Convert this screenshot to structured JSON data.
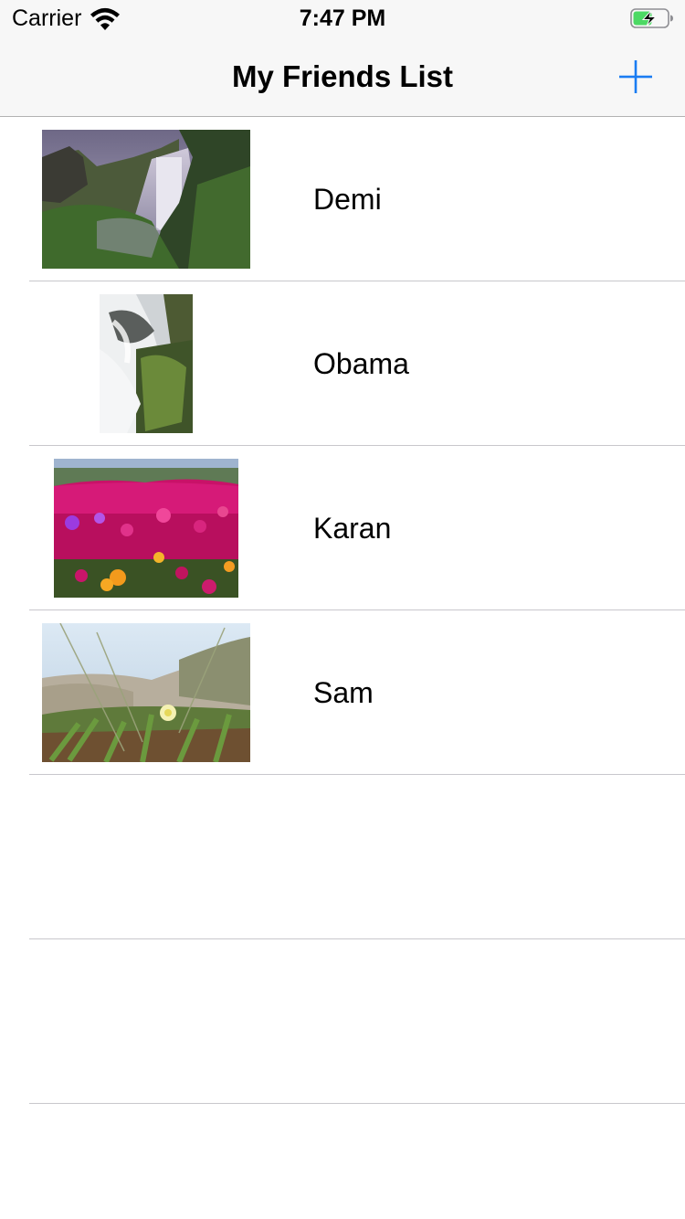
{
  "status_bar": {
    "carrier": "Carrier",
    "time": "7:47 PM",
    "wifi_icon": "wifi-icon",
    "battery_icon": "battery-charging-icon"
  },
  "nav_bar": {
    "title": "My Friends List",
    "add_icon": "plus-icon",
    "accent_color": "#1a7cf2"
  },
  "friends": [
    {
      "name": "Demi",
      "photo": "waterfall-cliff-photo"
    },
    {
      "name": "Obama",
      "photo": "waterfall-rocks-photo"
    },
    {
      "name": "Karan",
      "photo": "pink-flowers-photo"
    },
    {
      "name": "Sam",
      "photo": "beach-grass-flower-photo"
    }
  ],
  "empty_rows": 2
}
